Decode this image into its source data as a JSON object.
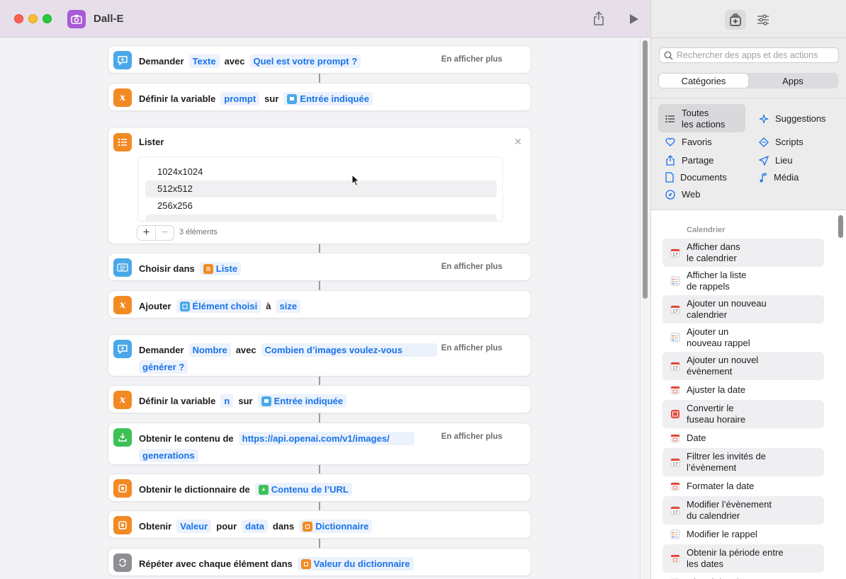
{
  "window": {
    "title": "Dall-E"
  },
  "actions": [
    {
      "verb": "Demander",
      "tokens": [
        {
          "kind": "param",
          "text": "Texte"
        },
        {
          "kind": "word",
          "text": "avec"
        },
        {
          "kind": "param",
          "text": "Quel est votre prompt ?"
        }
      ],
      "more": "En afficher plus"
    },
    {
      "verb": "Définir la variable",
      "tokens": [
        {
          "kind": "param",
          "text": "prompt"
        },
        {
          "kind": "word",
          "text": "sur"
        },
        {
          "kind": "var",
          "text": "Entrée indiquée"
        }
      ]
    },
    {
      "verb": "Lister",
      "items": [
        "1024x1024",
        "512x512",
        "256x256"
      ],
      "count": "3 éléments"
    },
    {
      "verb": "Choisir dans",
      "tokens": [
        {
          "kind": "var",
          "text": "Liste"
        }
      ],
      "more": "En afficher plus"
    },
    {
      "verb": "Ajouter",
      "tokens": [
        {
          "kind": "var",
          "text": "Élément choisi"
        },
        {
          "kind": "word",
          "text": "à"
        },
        {
          "kind": "param",
          "text": "size"
        }
      ]
    },
    {
      "verb": "Demander",
      "tokens": [
        {
          "kind": "param",
          "text": "Nombre"
        },
        {
          "kind": "word",
          "text": "avec"
        },
        {
          "kind": "param",
          "text": "Combien d’images voulez-vous"
        }
      ],
      "line2": "générer ?",
      "more": "En afficher plus"
    },
    {
      "verb": "Définir la variable",
      "tokens": [
        {
          "kind": "param",
          "text": "n"
        },
        {
          "kind": "word",
          "text": "sur"
        },
        {
          "kind": "var",
          "text": "Entrée indiquée"
        }
      ]
    },
    {
      "verb": "Obtenir le contenu de",
      "tokens": [
        {
          "kind": "param",
          "text": "https://api.openai.com/v1/images/"
        }
      ],
      "line2": "generations",
      "more": "En afficher plus"
    },
    {
      "verb": "Obtenir le dictionnaire de",
      "tokens": [
        {
          "kind": "var",
          "text": "Contenu de l’URL"
        }
      ]
    },
    {
      "verb": "Obtenir",
      "tokens": [
        {
          "kind": "param",
          "text": "Valeur"
        },
        {
          "kind": "word",
          "text": "pour"
        },
        {
          "kind": "param",
          "text": "data"
        },
        {
          "kind": "word",
          "text": "dans"
        },
        {
          "kind": "var",
          "text": "Dictionnaire"
        }
      ]
    },
    {
      "verb": "Répéter avec chaque élément dans",
      "tokens": [
        {
          "kind": "var",
          "text": "Valeur du dictionnaire"
        }
      ]
    }
  ],
  "sidebar": {
    "search_placeholder": "Rechercher des apps et des actions",
    "segments": [
      "Catégories",
      "Apps"
    ],
    "categories": [
      {
        "label": "Toutes\nles actions",
        "icon": "list-icon",
        "selected": true
      },
      {
        "label": "Suggestions",
        "icon": "sparkle-icon"
      },
      {
        "label": "Favoris",
        "icon": "heart-icon"
      },
      {
        "label": "Scripts",
        "icon": "scripts-icon"
      },
      {
        "label": "Partage",
        "icon": "share-icon"
      },
      {
        "label": "Lieu",
        "icon": "location-icon"
      },
      {
        "label": "Documents",
        "icon": "document-icon"
      },
      {
        "label": "Média",
        "icon": "music-note-icon"
      },
      {
        "label": "Web",
        "icon": "compass-icon"
      }
    ],
    "section": "Calendrier",
    "action_items": [
      {
        "label": "Afficher dans\nle calendrier",
        "icon": "calendar-icon"
      },
      {
        "label": "Afficher la liste\nde rappels",
        "icon": "reminders-icon"
      },
      {
        "label": "Ajouter un nouveau\ncalendrier",
        "icon": "calendar-icon"
      },
      {
        "label": "Ajouter un\nnouveau rappel",
        "icon": "reminders-icon"
      },
      {
        "label": "Ajouter un nouvel\névènement",
        "icon": "calendar-icon"
      },
      {
        "label": "Ajuster la date",
        "icon": "date-icon"
      },
      {
        "label": "Convertir le\nfuseau horaire",
        "icon": "clock-icon"
      },
      {
        "label": "Date",
        "icon": "date-icon"
      },
      {
        "label": "Filtrer les invités de\nl’évènement",
        "icon": "calendar-icon"
      },
      {
        "label": "Formater la date",
        "icon": "date-icon"
      },
      {
        "label": "Modifier l’évènement\ndu calendrier",
        "icon": "calendar-icon"
      },
      {
        "label": "Modifier le rappel",
        "icon": "reminders-icon"
      },
      {
        "label": "Obtenir la période entre\nles dates",
        "icon": "date-icon"
      },
      {
        "label": "Obtenir les dates",
        "icon": "date-icon"
      }
    ]
  }
}
